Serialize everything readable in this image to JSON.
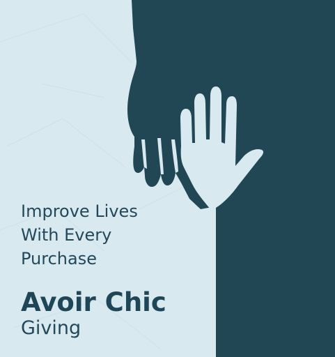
{
  "colors": {
    "background_light": "#d8eaf0",
    "panel_dark": "#214654",
    "text_dark": "#24485a"
  },
  "illustration": {
    "icon": "reaching-hands-icon"
  },
  "tagline": {
    "line1": "Improve Lives",
    "line2": "With Every",
    "line3": "Purchase"
  },
  "brand": {
    "name": "Avoir Chic",
    "subtitle": "Giving"
  }
}
